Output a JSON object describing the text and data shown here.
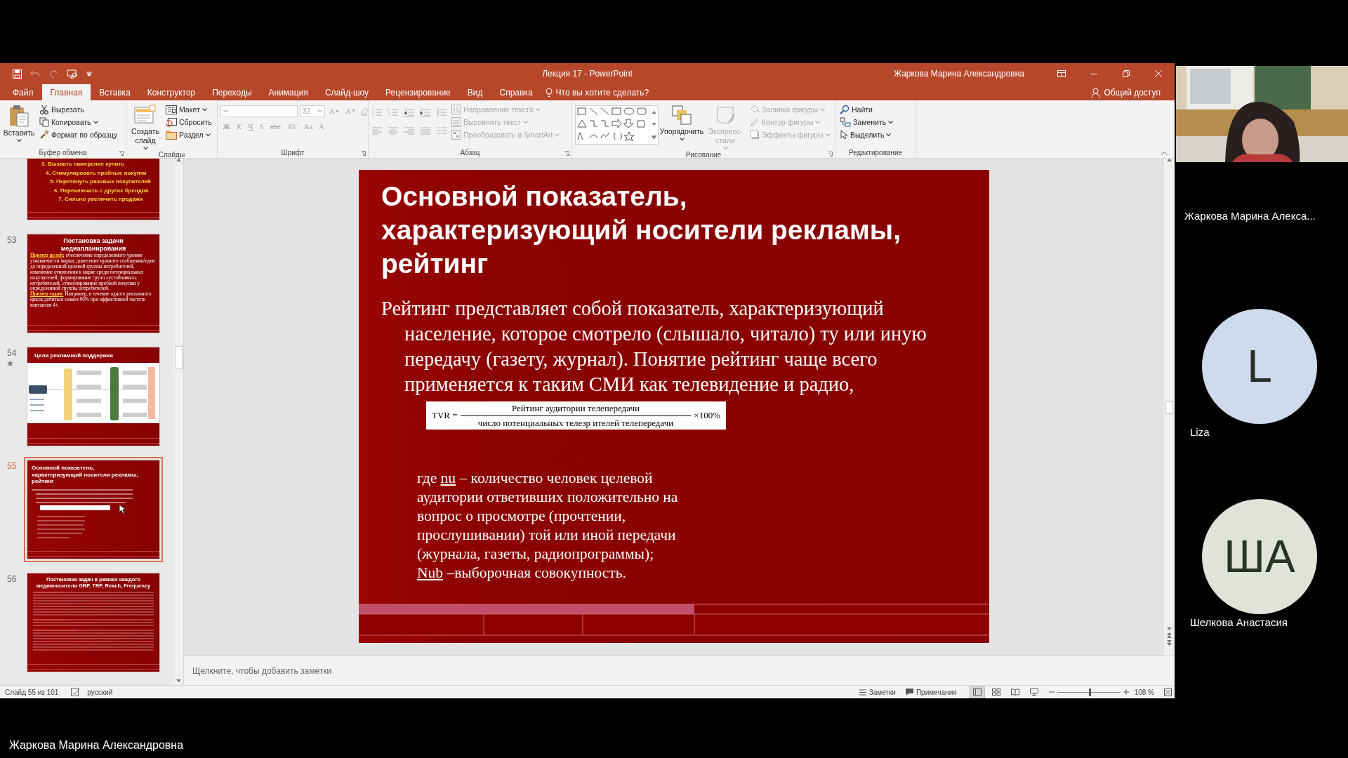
{
  "window": {
    "title": "Лекция 17 - PowerPoint",
    "user": "Жаркова Марина Александровна"
  },
  "tabs": [
    {
      "label": "Файл",
      "selected": false
    },
    {
      "label": "Главная",
      "selected": true
    },
    {
      "label": "Вставка",
      "selected": false
    },
    {
      "label": "Конструктор",
      "selected": false
    },
    {
      "label": "Переходы",
      "selected": false
    },
    {
      "label": "Анимация",
      "selected": false
    },
    {
      "label": "Слайд-шоу",
      "selected": false
    },
    {
      "label": "Рецензирование",
      "selected": false
    },
    {
      "label": "Вид",
      "selected": false
    },
    {
      "label": "Справка",
      "selected": false
    }
  ],
  "tell_me": "Что вы хотите сделать?",
  "share": "Общий доступ",
  "ribbon": [
    {
      "kind": "clipboard",
      "label": "Буфер обмена",
      "launcher": true,
      "items": [
        {
          "kind": "big",
          "label": "Вставить",
          "disabled": false,
          "dropdown": true
        },
        {
          "kind": "small",
          "label": "Вырезать",
          "disabled": false,
          "dropdown": false
        },
        {
          "kind": "small",
          "label": "Копировать",
          "disabled": false,
          "dropdown": true
        },
        {
          "kind": "small",
          "label": "Формат по образцу",
          "disabled": false,
          "dropdown": false
        }
      ]
    },
    {
      "kind": "slides",
      "label": "Слайды",
      "launcher": false,
      "items": [
        {
          "kind": "big",
          "label": "Создать слайд",
          "disabled": false,
          "dropdown": true
        },
        {
          "kind": "small",
          "label": "Макет",
          "disabled": false,
          "dropdown": true
        },
        {
          "kind": "small",
          "label": "Сбросить",
          "disabled": false,
          "dropdown": false
        },
        {
          "kind": "small",
          "label": "Раздел",
          "disabled": false,
          "dropdown": true
        }
      ]
    },
    {
      "kind": "font",
      "label": "Шрифт",
      "launcher": true,
      "size": "32",
      "row1": [
        {
          "label": "A",
          "disabled": true
        },
        {
          "label": "A",
          "disabled": true
        }
      ],
      "row2": [
        {
          "label": "Ж",
          "disabled": true
        },
        {
          "label": "К",
          "disabled": true
        },
        {
          "label": "Ч",
          "disabled": true
        },
        {
          "label": "S",
          "disabled": true
        },
        {
          "label": "abc",
          "disabled": true
        },
        {
          "label": "AV",
          "disabled": true
        },
        {
          "label": "Aa",
          "disabled": true
        },
        {
          "label": "A",
          "disabled": true
        }
      ]
    },
    {
      "kind": "paragraph",
      "label": "Абзац",
      "launcher": true,
      "items": [
        {
          "kind": "small",
          "label": "Направление текста",
          "disabled": true,
          "dropdown": true
        },
        {
          "kind": "small",
          "label": "Выровнять текст",
          "disabled": true,
          "dropdown": true
        },
        {
          "kind": "small",
          "label": "Преобразовать в SmartArt",
          "disabled": true,
          "dropdown": true
        }
      ]
    },
    {
      "kind": "drawing",
      "label": "Рисование",
      "launcher": true,
      "items": [
        {
          "kind": "big",
          "label": "Упорядочить",
          "disabled": false,
          "dropdown": true
        },
        {
          "kind": "big",
          "label": "Экспресс-стили",
          "disabled": true,
          "dropdown": true
        },
        {
          "kind": "small",
          "label": "Заливка фигуры",
          "disabled": true,
          "dropdown": true
        },
        {
          "kind": "small",
          "label": "Контур фигуры",
          "disabled": true,
          "dropdown": true
        },
        {
          "kind": "small",
          "label": "Эффекты фигуры",
          "disabled": true,
          "dropdown": true
        }
      ]
    },
    {
      "kind": "editing",
      "label": "Редактирование",
      "launcher": false,
      "items": [
        {
          "kind": "small",
          "label": "Найти",
          "disabled": false,
          "dropdown": false
        },
        {
          "kind": "small",
          "label": "Заменить",
          "disabled": false,
          "dropdown": true
        },
        {
          "kind": "small",
          "label": "Выделить",
          "disabled": false,
          "dropdown": true
        }
      ]
    }
  ],
  "thumbnails": [
    {
      "kind": "list",
      "selected": false,
      "animated": false,
      "items": [
        "3. Вызвать намерение купить",
        "4. Стимулировать пробные покупки",
        "5. Перетянуть разовых покупателей",
        "6. Переключить с других брендов",
        "7. Сильно увеличить продажи"
      ]
    },
    {
      "kind": "text",
      "number": "53",
      "selected": false,
      "animated": false,
      "title": "Постановка задачи медиапланирования",
      "paragraphs": [
        {
          "label": "Пример целей:",
          "text": " обеспечение определенного уровня узнаваемости марки; донесение нужного сообщения/идеи до определенной целевой группы потребителей, изменение отношения к марке среди потенциальных покупателей; формирование групп «устойчивых» потребителей, стимулирование пробной покупки у определенной группы потребителей."
        },
        {
          "label": "Пример задач:",
          "text": " Например, в течение одного рекламного цикла добиться охвата 90% при эффективной частоте контактов 4+."
        }
      ]
    },
    {
      "kind": "diagram",
      "number": "54",
      "selected": false,
      "animated": true,
      "title": "Цели рекламной поддержки"
    },
    {
      "kind": "current",
      "number": "55",
      "selected": true,
      "animated": false,
      "title": "Основной показатель,\nхарактеризующий носители рекламы,\nрейтинг"
    },
    {
      "kind": "dense",
      "number": "56",
      "selected": false,
      "animated": false,
      "title": "Постановка задач в рамках каждого медианосителя GRP, TRP, Reach, Frequency"
    }
  ],
  "slide": {
    "title": "Основной показатель,\nхарактеризующий носители рекламы,\nрейтинг",
    "body": "Рейтинг представляет собой показатель, характеризующий население, которое смотрело (слышало, читало) ту или иную передачу (газету, журнал). Понятие рейтинг чаще всего применяется к таким СМИ как телевидение и радио,",
    "formula": {
      "lhs": "TVR =",
      "numerator": "Рейтинг аудитории телепередачи",
      "denominator": "число потенциальных телезр ителей телепередачи",
      "factor": "×100%"
    },
    "definitions": [
      {
        "prefix": "где ",
        "term": "nu",
        "text": " – количество человек целевой аудитории ответивших положительно на вопрос о просмотре (прочтении, прослушивании) той или иной передачи (журнала, газеты, радиопрограммы);"
      },
      {
        "term": "Nub",
        "text": " –выборочная совокупность."
      }
    ]
  },
  "notes_placeholder": "Щелкните, чтобы добавить заметки",
  "status_bar": {
    "slide": "Слайд 55 из 101",
    "language": "русский",
    "notes": "Заметки",
    "comments": "Примечания",
    "views": [
      {
        "kind": "normal",
        "selected": true
      },
      {
        "kind": "sorter",
        "selected": false
      },
      {
        "kind": "reading",
        "selected": false
      },
      {
        "kind": "show",
        "selected": false
      }
    ],
    "zoom_slider": {
      "level": 0.51
    },
    "zoom": "108 %"
  },
  "participants": [
    {
      "kind": "video",
      "name": "Жаркова Марина Алекса..."
    },
    {
      "kind": "avatar",
      "name": "Liza",
      "initials": "L",
      "color": "#cfdbec"
    },
    {
      "kind": "avatar",
      "name": "Шелкова Анастасия",
      "initials": "ША",
      "color": "#dfe3d9"
    }
  ],
  "caption": "Жаркова Марина Александровна"
}
